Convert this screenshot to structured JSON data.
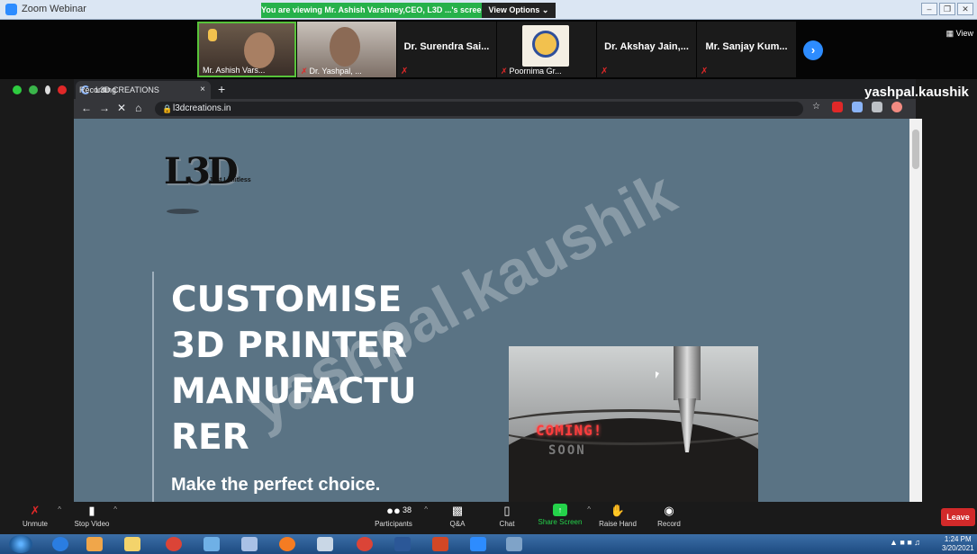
{
  "zoom": {
    "window_title": "Zoom Webinar",
    "viewing_banner": "You are viewing Mr. Ashish Varshney,CEO, L3D ...'s screen",
    "view_options": "View Options ⌄",
    "gallery_view_label": "View",
    "participants_tiles": [
      {
        "name": "Mr. Ashish Vars...",
        "video": true,
        "muted": false
      },
      {
        "name": "Dr. Yashpal, ...",
        "video": true,
        "muted": true
      },
      {
        "name": "Dr. Surendra Sai...",
        "video": false,
        "muted": true
      },
      {
        "name": "Poornima Gr...",
        "video": true,
        "muted": true
      },
      {
        "name": "Dr. Akshay Jain,...",
        "video": false,
        "muted": true
      },
      {
        "name": "Mr. Sanjay Kum...",
        "video": false,
        "muted": true
      }
    ],
    "presenter_watermark": "yashpal.kaushik",
    "controls": {
      "unmute": "Unmute",
      "stop_video": "Stop Video",
      "participants": "Participants",
      "participants_count": "38",
      "qa": "Q&A",
      "chat": "Chat",
      "share_screen": "Share Screen",
      "raise_hand": "Raise Hand",
      "record": "Record",
      "leave": "Leave"
    }
  },
  "browser": {
    "recording_label": "Recording",
    "tab_title": "L3D CREATIONS",
    "tab_close": "×",
    "new_tab": "+",
    "url": "l3dcreations.in",
    "nav": {
      "back": "←",
      "forward": "→",
      "stop": "✕",
      "home": "⌂"
    }
  },
  "site": {
    "logo_text": "L3D",
    "logo_tagline": "Just Limitless",
    "hero_lines": [
      "CUSTOMISE",
      "3D PRINTER",
      "MANUFACTU",
      "RER"
    ],
    "hero_subtitle": "Make the perfect choice.",
    "video_text_top": "COMING!",
    "video_text_bottom": "SOON",
    "share_watermark": "yashpal.kaushik"
  },
  "taskbar": {
    "time": "1:24 PM",
    "date": "3/20/2021"
  },
  "colors": {
    "page_bg": "#5a7384",
    "banner_green": "#26b14a",
    "zoom_blue": "#2d8cff",
    "leave_red": "#d22a2a"
  }
}
